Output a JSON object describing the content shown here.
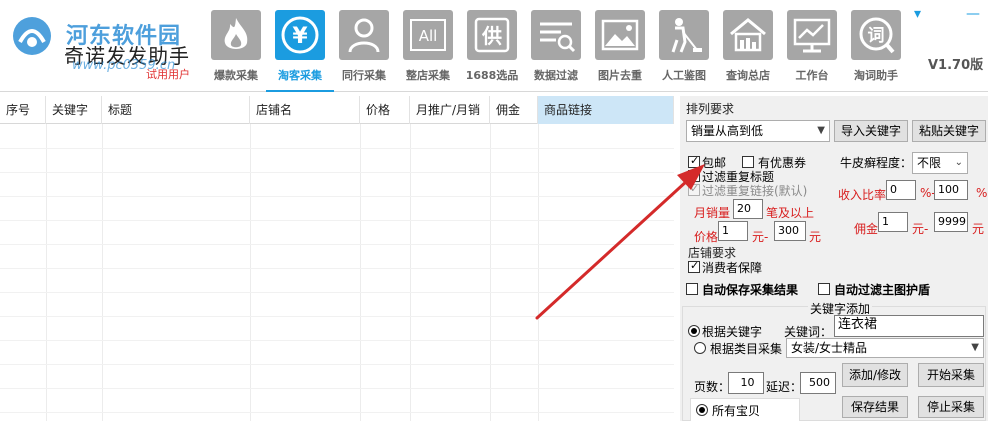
{
  "app": {
    "watermark_top": "河东软件园",
    "name": "奇诺发发助手",
    "watermark_url": "www.pc0359.cn",
    "trial_label": "试用用户",
    "version": "V1.70版",
    "window_controls": {
      "dropdown": "▾",
      "minimize": "—"
    }
  },
  "toolbar": [
    {
      "label": "爆款采集",
      "icon": "flame-icon"
    },
    {
      "label": "淘客采集",
      "icon": "yen-icon",
      "active": true
    },
    {
      "label": "同行采集",
      "icon": "person-icon"
    },
    {
      "label": "整店采集",
      "icon": "all-icon"
    },
    {
      "label": "1688选品",
      "icon": "gong-icon"
    },
    {
      "label": "数据过滤",
      "icon": "filter-icon"
    },
    {
      "label": "图片去重",
      "icon": "picture-icon"
    },
    {
      "label": "人工鉴图",
      "icon": "cleaner-icon"
    },
    {
      "label": "查询总店",
      "icon": "store-icon"
    },
    {
      "label": "工作台",
      "icon": "monitor-icon"
    },
    {
      "label": "淘词助手",
      "icon": "word-icon"
    }
  ],
  "toolbar_glyphs": {
    "all": "All",
    "gong": "供",
    "word": "词",
    "yen": "¥"
  },
  "table": {
    "columns": [
      "序号",
      "关键字",
      "标题",
      "店铺名",
      "价格",
      "月推广/月销",
      "佣金",
      "商品链接"
    ],
    "rows": []
  },
  "panel": {
    "sort_title": "排列要求",
    "sort_select": "销量从高到低",
    "import_keyword": "导入关键字",
    "paste_keyword": "粘贴关键字",
    "free_shipping": {
      "label": "包邮",
      "checked": true
    },
    "has_coupon": {
      "label": "有优惠券",
      "checked": false
    },
    "cowhide_label": "牛皮癣程度：",
    "cowhide_select": "不限",
    "filter_dup_title": {
      "label": "过滤重复标题",
      "checked": false
    },
    "filter_dup_link": {
      "label": "过滤重复链接(默认)",
      "checked": true
    },
    "income_label": "收入比率",
    "income_min": "0",
    "income_sep": "%-",
    "income_max": "100",
    "income_unit": "%",
    "monthly_label": "月销量",
    "monthly_value": "20",
    "monthly_unit": "笔及以上",
    "price_label": "价格",
    "price_min": "1",
    "price_sep": "元-",
    "price_max": "300",
    "price_unit": "元",
    "commission_label": "佣金",
    "commission_min": "1",
    "commission_sep": "元-",
    "commission_max": "9999",
    "commission_unit": "元",
    "shop_title": "店铺要求",
    "consumer_guarantee": {
      "label": "消费者保障",
      "checked": true
    },
    "auto_save": {
      "label": "自动保存采集结果",
      "checked": false
    },
    "auto_filter_image": {
      "label": "自动过滤主图护盾",
      "checked": false
    },
    "keyword_add_title": "关键字添加",
    "by_keyword": {
      "label": "根据关键字",
      "selected": true
    },
    "keyword_label": "关键词：",
    "keyword_value": "连衣裙",
    "by_category": {
      "label": "根据类目采集",
      "selected": false
    },
    "category_select": "女装/女士精品",
    "add_edit": "添加/修改",
    "start_collect": "开始采集",
    "pages_label": "页数：",
    "pages_value": "10",
    "delay_label": "延迟：",
    "delay_value": "500",
    "save_result": "保存结果",
    "stop_collect": "停止采集",
    "all_items": {
      "label": "所有宝贝",
      "selected": true
    }
  },
  "colors": {
    "accent": "#1b9ce0",
    "annotation_arrow": "#d42a2a",
    "icon_gray": "#a6a6a6",
    "price_red": "#d81e1e"
  }
}
